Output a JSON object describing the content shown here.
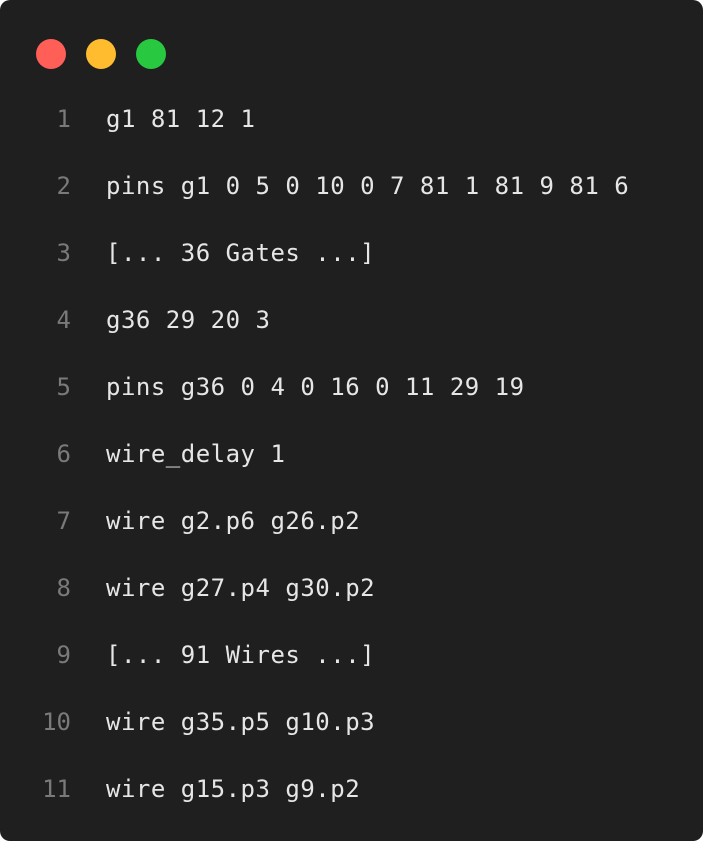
{
  "window": {
    "traffic_lights": [
      {
        "name": "close",
        "color": "#ff5f57"
      },
      {
        "name": "minimize",
        "color": "#febc2e"
      },
      {
        "name": "zoom",
        "color": "#28c840"
      }
    ]
  },
  "code": {
    "lines": [
      {
        "number": "1",
        "text": "g1 81 12 1"
      },
      {
        "number": "2",
        "text": "pins g1 0 5 0 10 0 7 81 1 81 9 81 6"
      },
      {
        "number": "3",
        "text": "[... 36 Gates ...]"
      },
      {
        "number": "4",
        "text": "g36 29 20 3"
      },
      {
        "number": "5",
        "text": "pins g36 0 4 0 16 0 11 29 19"
      },
      {
        "number": "6",
        "text": "wire_delay 1"
      },
      {
        "number": "7",
        "text": "wire g2.p6 g26.p2"
      },
      {
        "number": "8",
        "text": "wire g27.p4 g30.p2"
      },
      {
        "number": "9",
        "text": "[... 91 Wires ...]"
      },
      {
        "number": "10",
        "text": "wire g35.p5 g10.p3"
      },
      {
        "number": "11",
        "text": "wire g15.p3 g9.p2"
      }
    ]
  }
}
